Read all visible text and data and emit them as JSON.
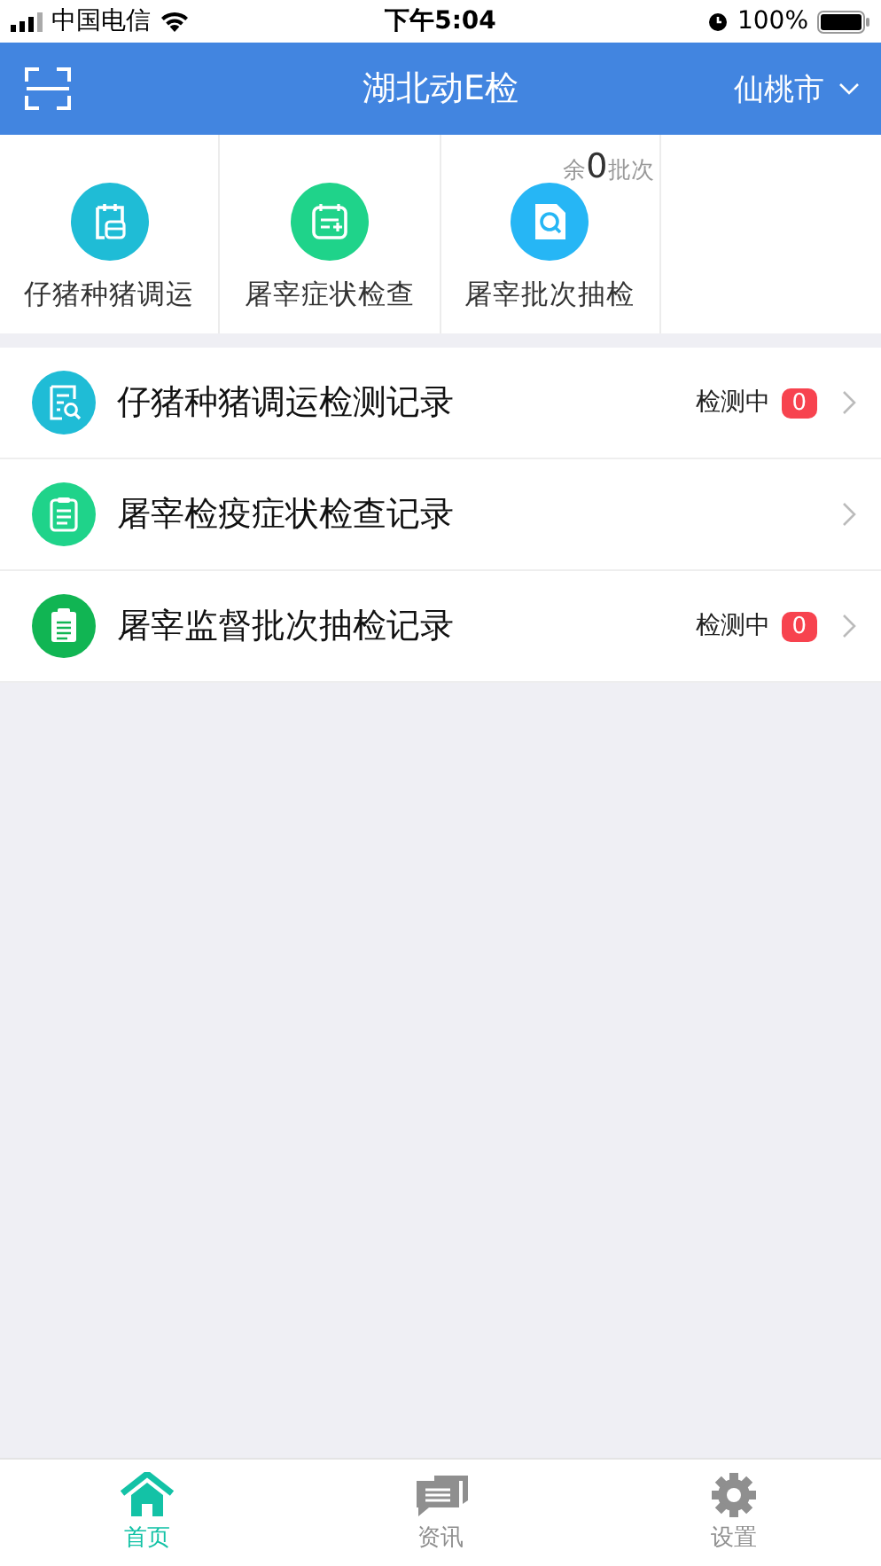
{
  "status_bar": {
    "carrier": "中国电信",
    "time": "下午5:04",
    "battery": "100%"
  },
  "header": {
    "title": "湖北动E检",
    "city": "仙桃市"
  },
  "shortcuts": [
    {
      "label": "仔猪种猪调运",
      "kind": "transport",
      "color": "#1fbcd6"
    },
    {
      "label": "屠宰症状检查",
      "kind": "calendar",
      "color": "#1fd38a"
    },
    {
      "label": "屠宰批次抽检",
      "kind": "doc-search",
      "color": "#26b6f5",
      "note_prefix": "余",
      "note_count": "0",
      "note_suffix": "批次"
    }
  ],
  "records": [
    {
      "title": "仔猪种猪调运检测记录",
      "kind": "report-search",
      "color": "#1fbcd6",
      "status": "检测中",
      "count": "0"
    },
    {
      "title": "屠宰检疫症状检查记录",
      "kind": "clipboard",
      "color": "#1fd38a"
    },
    {
      "title": "屠宰监督批次抽检记录",
      "kind": "clipboard-filled",
      "color": "#11b553",
      "status": "检测中",
      "count": "0"
    }
  ],
  "tabs": [
    {
      "label": "首页",
      "kind": "home",
      "selected": true
    },
    {
      "label": "资讯",
      "kind": "news",
      "selected": false
    },
    {
      "label": "设置",
      "kind": "settings",
      "selected": false
    }
  ]
}
